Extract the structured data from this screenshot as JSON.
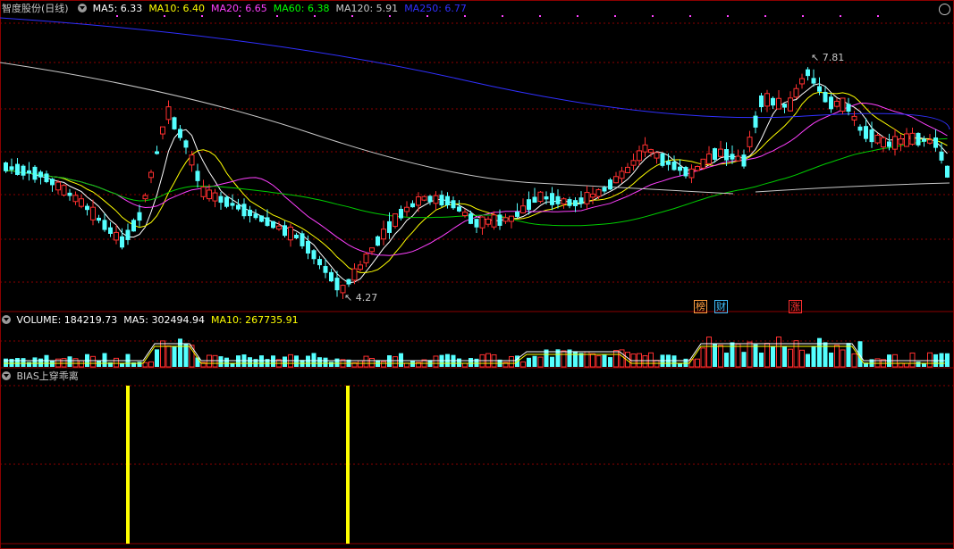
{
  "header": {
    "stock_title": "智度股份(日线)",
    "ma": [
      {
        "label": "MA5: 6.33",
        "color": "#ffffff"
      },
      {
        "label": "MA10: 6.40",
        "color": "#ffff00"
      },
      {
        "label": "MA20: 6.65",
        "color": "#ff40ff"
      },
      {
        "label": "MA60: 6.38",
        "color": "#00ff00"
      },
      {
        "label": "MA120: 5.91",
        "color": "#c8c8c8"
      },
      {
        "label": "MA250: 6.77",
        "color": "#3030ff"
      }
    ]
  },
  "price_panel": {
    "high_label": "7.81",
    "low_label": "4.27",
    "event_tags": [
      {
        "text": "榜",
        "color": "#ffa040"
      },
      {
        "text": "财",
        "color": "#40c0ff"
      },
      {
        "text": "涨",
        "color": "#ff3030"
      }
    ]
  },
  "volume_panel": {
    "items": [
      {
        "label": "VOLUME: 184219.73",
        "color": "#ffffff"
      },
      {
        "label": "MA5: 302494.94",
        "color": "#ffffff"
      },
      {
        "label": "MA10: 267735.91",
        "color": "#ffff00"
      }
    ]
  },
  "indicator_panel": {
    "title": "BIAS上穿乖离"
  },
  "colors": {
    "up": "#ff3030",
    "down": "#54ffff",
    "grid": "#8b0000",
    "signal": "#ffff00"
  }
}
